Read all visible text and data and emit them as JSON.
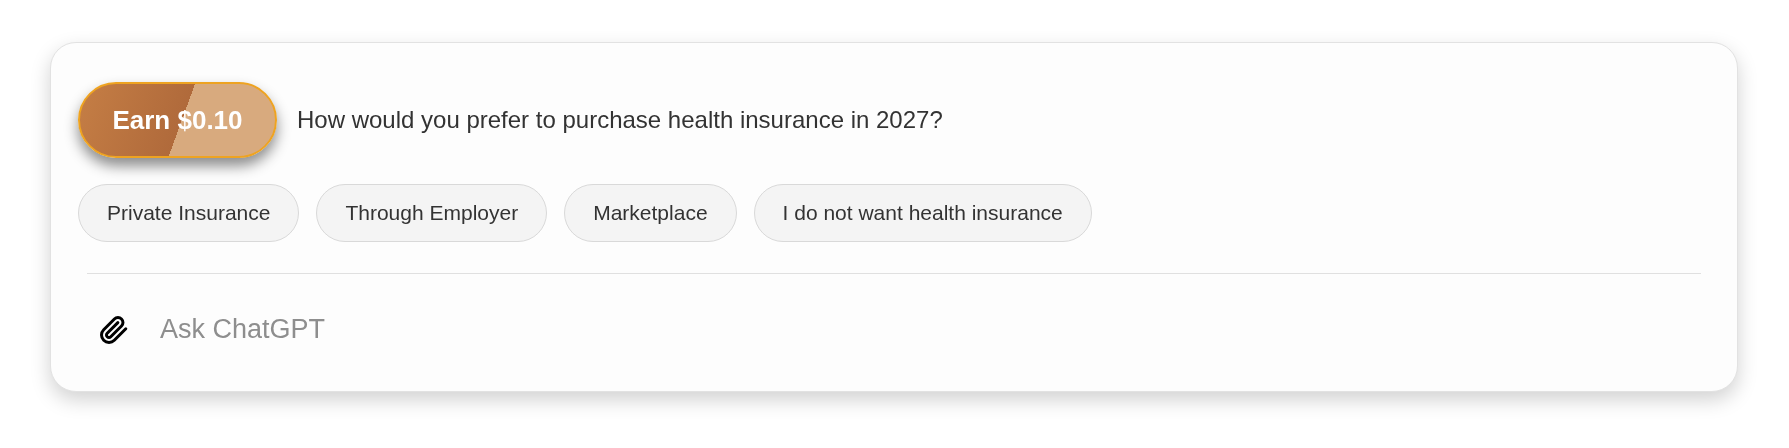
{
  "reward_badge": {
    "label": "Earn $0.10"
  },
  "question": "How would you prefer to purchase health insurance in 2027?",
  "options": [
    {
      "label": "Private Insurance"
    },
    {
      "label": "Through Employer"
    },
    {
      "label": "Marketplace"
    },
    {
      "label": "I do not want health insurance"
    }
  ],
  "composer": {
    "placeholder": "Ask ChatGPT"
  }
}
